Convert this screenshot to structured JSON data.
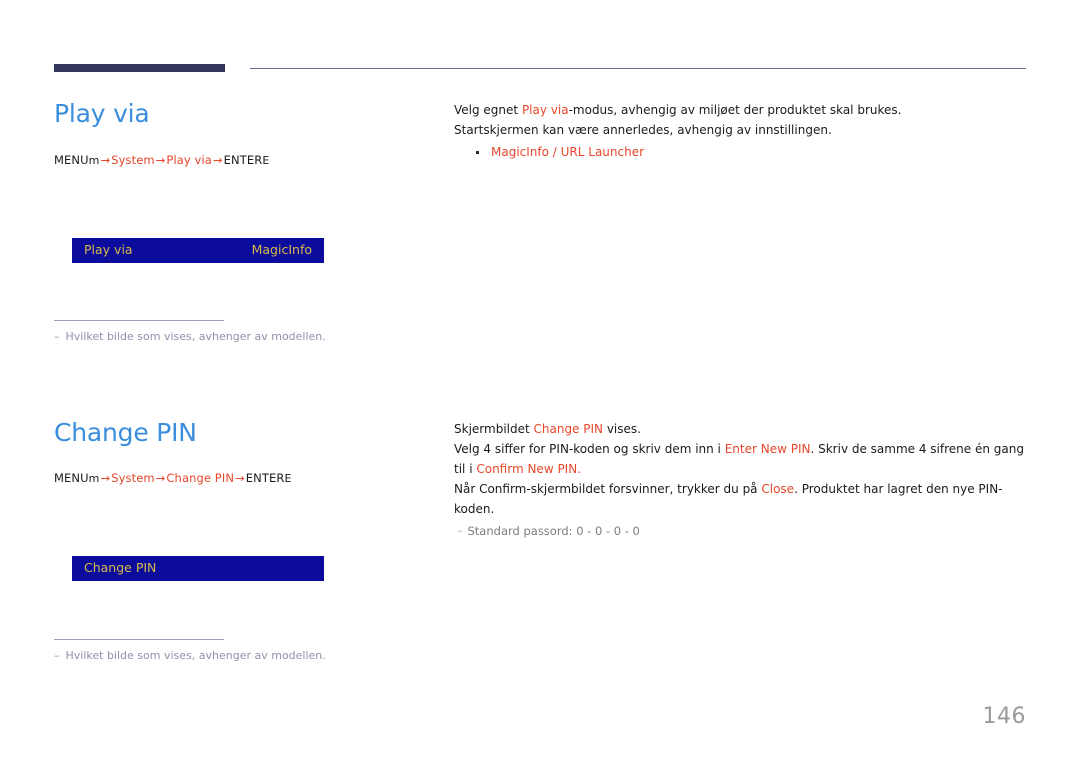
{
  "page": {
    "number": "146",
    "accent_color": "#e8472b",
    "heading_color": "#3b8ede",
    "osd_bg_color": "#0b0b9c",
    "osd_text_color": "#d8b84a",
    "rule_color": "#32365c"
  },
  "sections": [
    {
      "id": "play-via",
      "title": "Play via",
      "breadcrumb": {
        "prefix": "MENU",
        "prefix_key": "m",
        "arrow": "→",
        "items": [
          "System",
          "Play via"
        ],
        "suffix": "ENTER",
        "suffix_key": "E"
      },
      "osd": {
        "label": "Play via",
        "value": "MagicInfo"
      },
      "footnote": {
        "dash": "–",
        "text": "Hvilket bilde som vises, avhenger av modellen."
      },
      "body": [
        {
          "type": "paragraph",
          "runs": [
            {
              "text": "Velg egnet ",
              "accent": false
            },
            {
              "text": "Play via",
              "accent": true
            },
            {
              "text": "-modus, avhengig av miljøet der produktet skal brukes.",
              "accent": false
            }
          ]
        },
        {
          "type": "paragraph",
          "runs": [
            {
              "text": "Startskjermen kan være annerledes, avhengig av innstillingen.",
              "accent": false
            }
          ]
        },
        {
          "type": "bullet",
          "text": "MagicInfo / URL Launcher"
        }
      ]
    },
    {
      "id": "change-pin",
      "title": "Change PIN",
      "breadcrumb": {
        "prefix": "MENU",
        "prefix_key": "m",
        "arrow": "→",
        "items": [
          "System",
          "Change PIN"
        ],
        "suffix": "ENTER",
        "suffix_key": "E"
      },
      "osd": {
        "label": "Change PIN",
        "value": ""
      },
      "footnote": {
        "dash": "–",
        "text": "Hvilket bilde som vises, avhenger av modellen."
      },
      "body": [
        {
          "type": "paragraph",
          "runs": [
            {
              "text": "Skjermbildet ",
              "accent": false
            },
            {
              "text": "Change PIN",
              "accent": true
            },
            {
              "text": " vises.",
              "accent": false
            }
          ]
        },
        {
          "type": "paragraph",
          "runs": [
            {
              "text": "Velg 4 siffer for PIN-koden og skriv dem inn i ",
              "accent": false
            },
            {
              "text": "Enter New PIN",
              "accent": true
            },
            {
              "text": ". Skriv de samme 4 sifrene én gang til i ",
              "accent": false
            },
            {
              "text": "Confirm New PIN",
              "accent": true
            },
            {
              "text": ".",
              "accent": false
            }
          ]
        },
        {
          "type": "paragraph",
          "runs": [
            {
              "text": "Når Confirm-skjermbildet forsvinner, trykker du på ",
              "accent": false
            },
            {
              "text": "Close",
              "accent": true
            },
            {
              "text": ". Produktet har lagret den nye PIN-koden.",
              "accent": false
            }
          ]
        },
        {
          "type": "subnote",
          "dash": "–",
          "text": "Standard passord: 0 - 0 - 0 - 0"
        }
      ]
    }
  ]
}
